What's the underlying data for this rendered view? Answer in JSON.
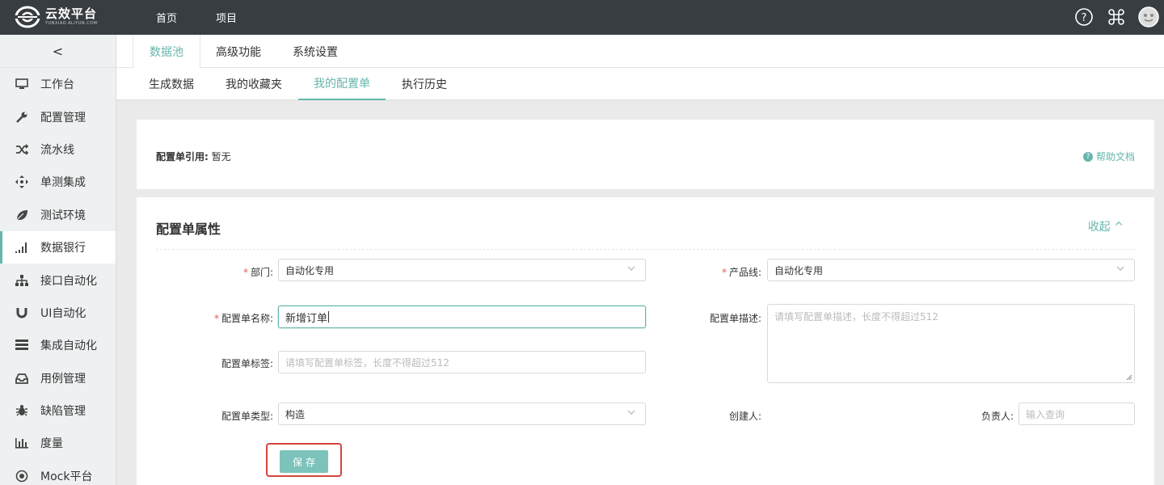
{
  "topbar": {
    "logo_main": "云效平台",
    "logo_sub": "YUNXIAO.ALIYUN.COM",
    "nav": [
      "首页",
      "项目"
    ]
  },
  "sidebar": {
    "collapse": "<",
    "items": [
      {
        "label": "工作台",
        "icon": "monitor-icon"
      },
      {
        "label": "配置管理",
        "icon": "wrench-icon"
      },
      {
        "label": "流水线",
        "icon": "shuffle-icon"
      },
      {
        "label": "单测集成",
        "icon": "crosshair-icon"
      },
      {
        "label": "测试环境",
        "icon": "leaf-icon"
      },
      {
        "label": "数据银行",
        "icon": "signal-bars-icon",
        "active": true
      },
      {
        "label": "接口自动化",
        "icon": "sitemap-icon"
      },
      {
        "label": "UI自动化",
        "icon": "magnet-icon"
      },
      {
        "label": "集成自动化",
        "icon": "server-stack-icon"
      },
      {
        "label": "用例管理",
        "icon": "inbox-icon"
      },
      {
        "label": "缺陷管理",
        "icon": "bug-icon"
      },
      {
        "label": "度量",
        "icon": "bar-chart-icon"
      },
      {
        "label": "Mock平台",
        "icon": "target-icon"
      }
    ]
  },
  "tabs_primary": [
    "数据池",
    "高级功能",
    "系统设置"
  ],
  "tabs_secondary": [
    "生成数据",
    "我的收藏夹",
    "我的配置单",
    "执行历史"
  ],
  "reference": {
    "label": "配置单引用:",
    "value": "暂无"
  },
  "help": "帮助文档",
  "section": {
    "title": "配置单属性",
    "fold": "收起 ^"
  },
  "form": {
    "dept_label": "部门:",
    "dept_value": "自动化专用",
    "product_label": "产品线:",
    "product_value": "自动化专用",
    "name_label": "配置单名称:",
    "name_value": "新增订单",
    "desc_label": "配置单描述:",
    "desc_placeholder": "请填写配置单描述，长度不得超过512",
    "tag_label": "配置单标签:",
    "tag_placeholder": "请填写配置单标签，长度不得超过512",
    "type_label": "配置单类型:",
    "type_value": "构造",
    "creator_label": "创建人:",
    "owner_label": "负责人:",
    "owner_placeholder": "输入查询",
    "required_mark": "*"
  },
  "save_label": "保存",
  "colors": {
    "accent": "#66b6ad",
    "topbar": "#373d41",
    "highlight": "#d2473a"
  }
}
